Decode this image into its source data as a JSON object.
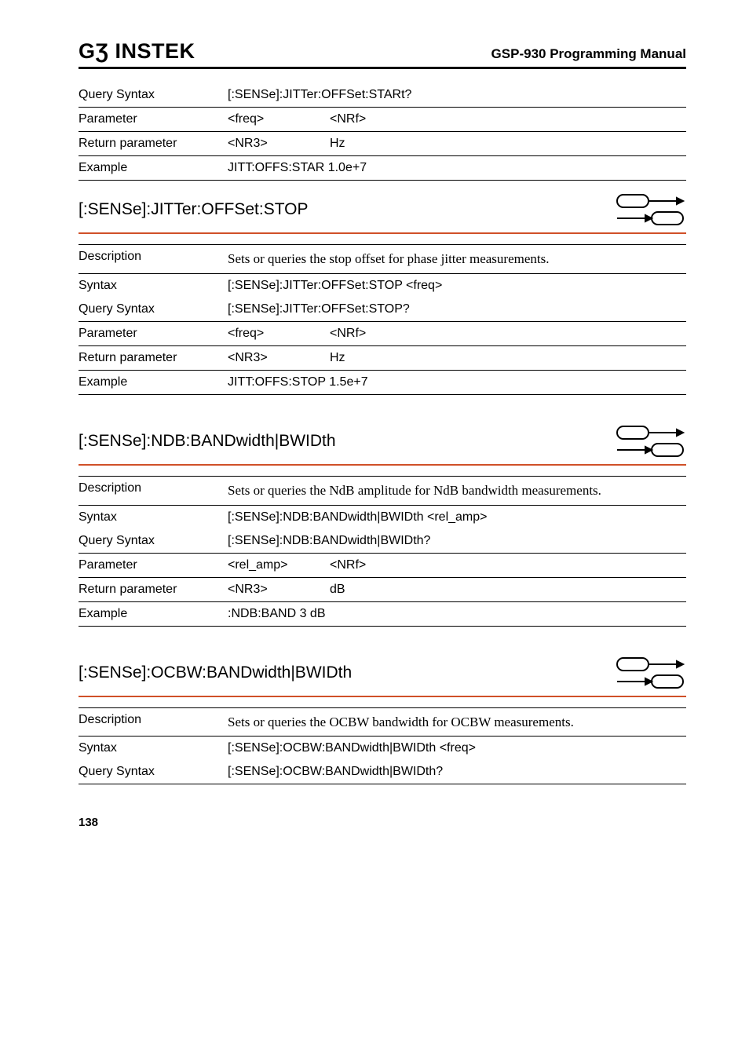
{
  "header": {
    "brand": "GƷ INSTEK",
    "manual": "GSP-930 Programming Manual"
  },
  "block1": {
    "query_syntax_label": "Query Syntax",
    "query_syntax_value": "[:SENSe]:JITTer:OFFSet:STARt?",
    "parameter_label": "Parameter",
    "parameter_col2": "<freq>",
    "parameter_col3": "<NRf>",
    "return_label": "Return parameter",
    "return_col2": "<NR3>",
    "return_col3": "Hz",
    "example_label": "Example",
    "example_value": "JITT:OFFS:STAR 1.0e+7"
  },
  "section2": {
    "heading": "[:SENSe]:JITTer:OFFSet:STOP",
    "description_label": "Description",
    "description_text": "Sets or queries the stop offset for phase jitter measurements.",
    "syntax_label": "Syntax",
    "syntax_value": "[:SENSe]:JITTer:OFFSet:STOP <freq>",
    "query_syntax_label": "Query Syntax",
    "query_syntax_value": "[:SENSe]:JITTer:OFFSet:STOP?",
    "parameter_label": "Parameter",
    "parameter_col2": "<freq>",
    "parameter_col3": "<NRf>",
    "return_label": "Return parameter",
    "return_col2": "<NR3>",
    "return_col3": "Hz",
    "example_label": "Example",
    "example_value": "JITT:OFFS:STOP 1.5e+7"
  },
  "section3": {
    "heading": "[:SENSe]:NDB:BANDwidth|BWIDth",
    "description_label": "Description",
    "description_text": "Sets or queries the NdB amplitude for NdB bandwidth measurements.",
    "syntax_label": "Syntax",
    "syntax_value": "[:SENSe]:NDB:BANDwidth|BWIDth <rel_amp>",
    "query_syntax_label": "Query Syntax",
    "query_syntax_value": "[:SENSe]:NDB:BANDwidth|BWIDth?",
    "parameter_label": "Parameter",
    "parameter_col2": "<rel_amp>",
    "parameter_col3": "<NRf>",
    "return_label": "Return parameter",
    "return_col2": "<NR3>",
    "return_col3": "dB",
    "example_label": "Example",
    "example_value": ":NDB:BAND 3 dB"
  },
  "section4": {
    "heading": "[:SENSe]:OCBW:BANDwidth|BWIDth",
    "description_label": "Description",
    "description_text": "Sets or queries the OCBW bandwidth for OCBW measurements.",
    "syntax_label": "Syntax",
    "syntax_value": "[:SENSe]:OCBW:BANDwidth|BWIDth <freq>",
    "query_syntax_label": "Query Syntax",
    "query_syntax_value": "[:SENSe]:OCBW:BANDwidth|BWIDth?"
  },
  "page_number": "138"
}
